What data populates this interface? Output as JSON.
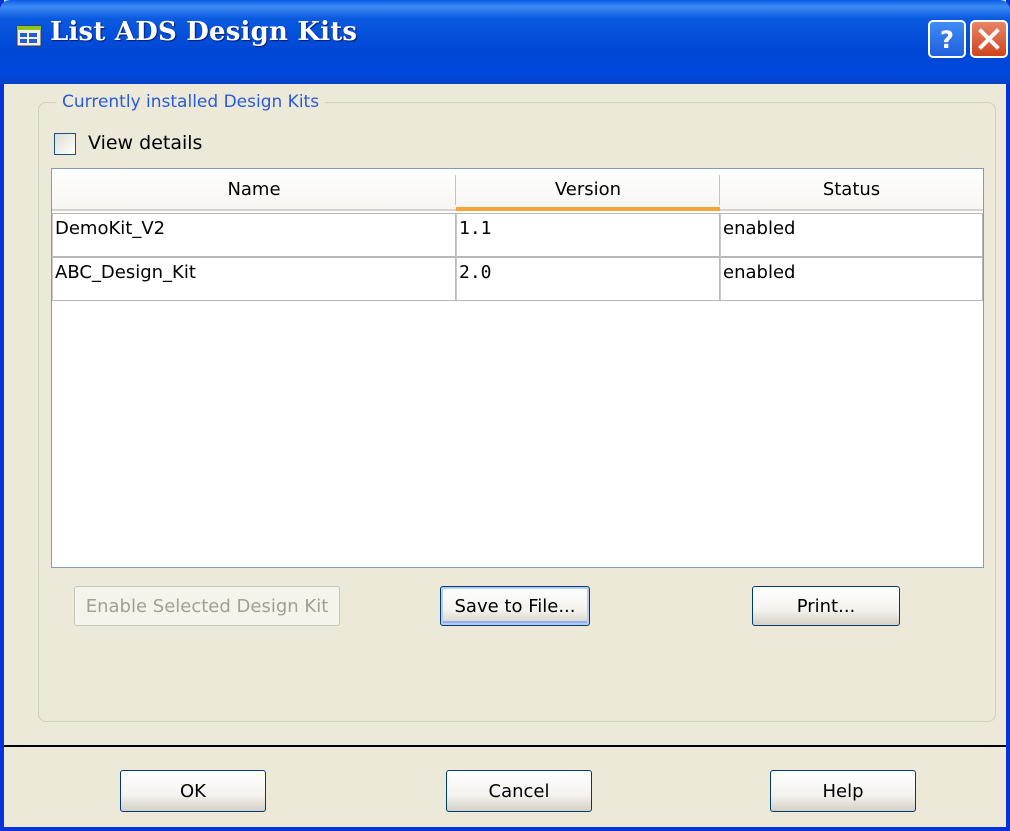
{
  "window": {
    "title": "List ADS Design Kits"
  },
  "group": {
    "legend": "Currently installed Design Kits"
  },
  "view_details": {
    "label": "View details",
    "checked": false
  },
  "table": {
    "columns": [
      "Name",
      "Version",
      "Status"
    ],
    "sorted_column": "Version",
    "rows": [
      {
        "name": "DemoKit_V2",
        "version": "1.1",
        "status": "enabled"
      },
      {
        "name": "ABC_Design_Kit",
        "version": "2.0",
        "status": "enabled"
      }
    ]
  },
  "actions": {
    "enable": "Enable Selected Design Kit",
    "save": "Save to File...",
    "print": "Print..."
  },
  "footer": {
    "ok": "OK",
    "cancel": "Cancel",
    "help": "Help"
  },
  "icons": {
    "app": "design-kit-window-icon",
    "help": "help-question-icon",
    "close": "close-x-icon"
  },
  "colors": {
    "titlebar": "#0054e3",
    "sort_indicator": "#f8a335",
    "group_legend": "#2a5bd7",
    "close_button": "#d8532c"
  }
}
